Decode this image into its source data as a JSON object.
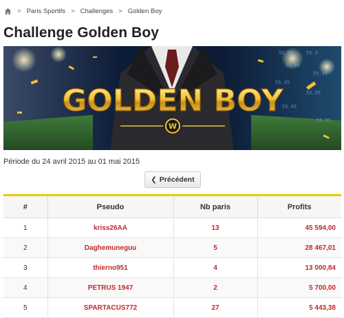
{
  "breadcrumb": {
    "home_icon": "home-icon",
    "separator": ">",
    "items": [
      "Paris Sportifs",
      "Challenges",
      "Golden Boy"
    ]
  },
  "page": {
    "title": "Challenge Golden Boy"
  },
  "banner": {
    "text": "GOLDEN BOY",
    "emblem": "W"
  },
  "periode": "Période du 24 avril 2015 au 01 mai 2015",
  "nav": {
    "prev_label": "Précédent",
    "prev_icon": "chevron-left-icon"
  },
  "table": {
    "headers": [
      "#",
      "Pseudo",
      "Nb paris",
      "Profits"
    ],
    "rows": [
      {
        "rank": "1",
        "pseudo": "kriss26AA",
        "nb": "13",
        "profit": "45 594,00"
      },
      {
        "rank": "2",
        "pseudo": "Daghemuneguu",
        "nb": "5",
        "profit": "28 467,01"
      },
      {
        "rank": "3",
        "pseudo": "thierno951",
        "nb": "4",
        "profit": "13 000,84"
      },
      {
        "rank": "4",
        "pseudo": "PETRUS 1947",
        "nb": "2",
        "profit": "5 700,00"
      },
      {
        "rank": "5",
        "pseudo": "SPARTACUS772",
        "nb": "27",
        "profit": "5 443,38"
      }
    ]
  },
  "colors": {
    "accent_gold": "#f2c500",
    "link_red": "#c0282d"
  }
}
